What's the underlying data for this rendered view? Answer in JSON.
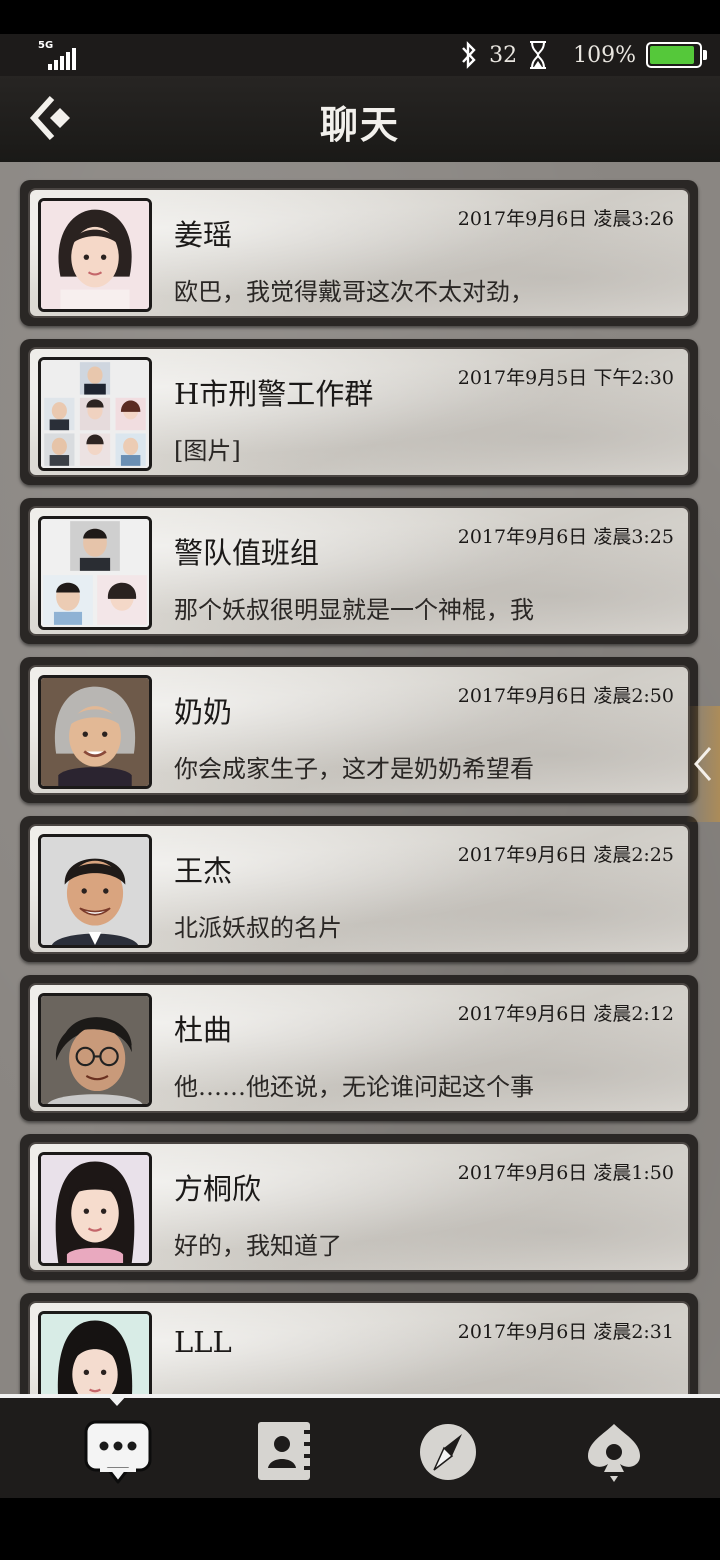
{
  "status": {
    "network": "5G",
    "bluetooth_icon": "bluetooth-icon",
    "notification_count": "32",
    "hourglass_icon": "hourglass-icon",
    "battery_percent": "109%",
    "battery_level": 1.0,
    "battery_color": "#55c83a"
  },
  "header": {
    "title": "聊天",
    "back_icon": "back-arrow-icon"
  },
  "chats": [
    {
      "name": "姜瑶",
      "time": "2017年9月6日 凌晨3:26",
      "message": "欧巴，我觉得戴哥这次不太对劲，"
    },
    {
      "name": "H市刑警工作群",
      "time": "2017年9月5日 下午2:30",
      "message": "[图片]"
    },
    {
      "name": "警队值班组",
      "time": "2017年9月6日 凌晨3:25",
      "message": "那个妖叔很明显就是一个神棍，我"
    },
    {
      "name": "奶奶",
      "time": "2017年9月6日 凌晨2:50",
      "message": "你会成家生子，这才是奶奶希望看"
    },
    {
      "name": "王杰",
      "time": "2017年9月6日 凌晨2:25",
      "message": "北派妖叔的名片"
    },
    {
      "name": "杜曲",
      "time": "2017年9月6日 凌晨2:12",
      "message": "他……他还说，无论谁问起这个事"
    },
    {
      "name": "方桐欣",
      "time": "2017年9月6日 凌晨1:50",
      "message": "好的，我知道了"
    },
    {
      "name": "LLL",
      "time": "2017年9月6日 凌晨2:31",
      "message": ""
    }
  ],
  "tabs": [
    {
      "icon": "chat-bubble-icon",
      "active": true
    },
    {
      "icon": "contacts-book-icon",
      "active": false
    },
    {
      "icon": "compass-icon",
      "active": false
    },
    {
      "icon": "spade-pin-icon",
      "active": false
    }
  ]
}
